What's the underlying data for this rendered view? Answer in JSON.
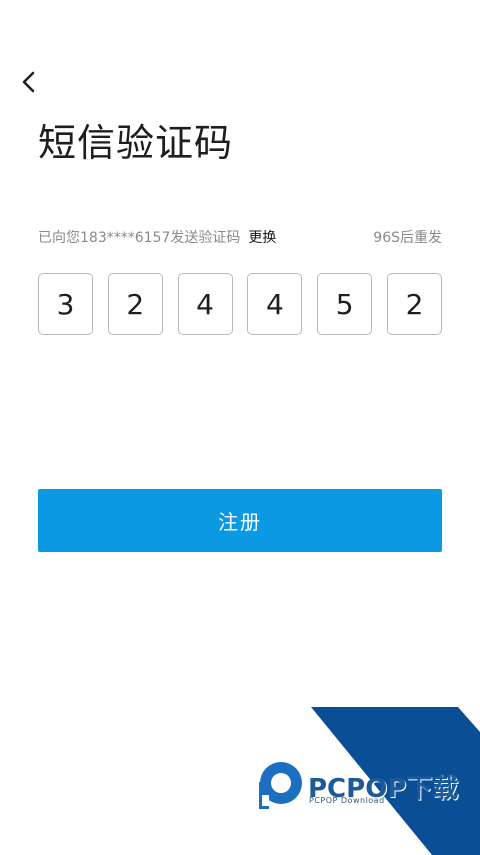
{
  "header": {
    "back_icon": "chevron-left-icon",
    "title": "短信验证码"
  },
  "verification": {
    "sent_text": "已向您183****6157发送验证码",
    "change_label": "更换",
    "resend_countdown": "96S后重发",
    "digits": [
      "3",
      "2",
      "4",
      "4",
      "5",
      "2"
    ]
  },
  "actions": {
    "register_label": "注册"
  },
  "watermark": {
    "brand": "PCPOP下载",
    "subtitle": "PCPOP Download"
  },
  "colors": {
    "primary": "#0b99e3",
    "watermark_blue": "#1c5a99"
  }
}
